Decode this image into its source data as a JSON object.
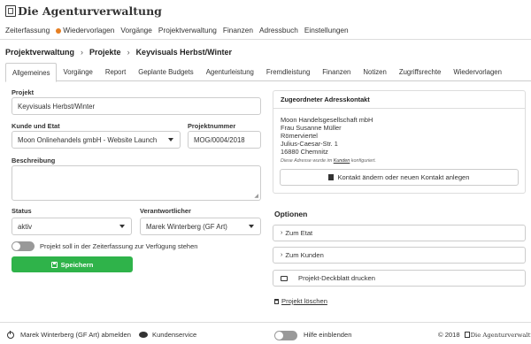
{
  "app": {
    "title": "Die Agenturverwaltung"
  },
  "topnav": [
    "Zeiterfassung",
    "Wiedervorlagen",
    "Vorgänge",
    "Projektverwaltung",
    "Finanzen",
    "Adressbuch",
    "Einstellungen"
  ],
  "breadcrumb": [
    "Projektverwaltung",
    "Projekte",
    "Keyvisuals Herbst/Winter"
  ],
  "tabs": [
    "Allgemeines",
    "Vorgänge",
    "Report",
    "Geplante Budgets",
    "Agenturleistung",
    "Fremdleistung",
    "Finanzen",
    "Notizen",
    "Zugriffsrechte",
    "Wiedervorlagen"
  ],
  "form": {
    "projekt_label": "Projekt",
    "projekt_value": "Keyvisuals Herbst/Winter",
    "kunde_label": "Kunde und Etat",
    "kunde_value": "Moon Onlinehandels gmbH - Website Launch",
    "projektnummer_label": "Projektnummer",
    "projektnummer_value": "MOG/0004/2018",
    "beschreibung_label": "Beschreibung",
    "beschreibung_value": "",
    "status_label": "Status",
    "status_value": "aktiv",
    "verantwortlich_label": "Verantwortlicher",
    "verantwortlich_value": "Marek Winterberg (GF Art)",
    "zeiterfassung_toggle_label": "Projekt soll in der Zeiterfassung zur Verfügung stehen",
    "save_label": "Speichern"
  },
  "contact": {
    "title": "Zugeordneter Adresskontakt",
    "lines": [
      "Moon Handelsgesellschaft mbH",
      "Frau Susanne Müller",
      "Römerviertel",
      "Julius-Caesar-Str. 1",
      "16880 Chemnitz"
    ],
    "note_prefix": "Diese Adresse wurde im ",
    "note_link": "Kunden",
    "note_suffix": " konfiguriert.",
    "change_button": "Kontakt ändern oder neuen Kontakt anlegen"
  },
  "options": {
    "title": "Optionen",
    "etat": "Zum Etat",
    "kunde": "Zum Kunden",
    "deckblatt": "Projekt-Deckblatt drucken",
    "delete": "Projekt löschen"
  },
  "footer": {
    "logout": "Marek Winterberg (GF Art) abmelden",
    "service": "Kundenservice",
    "help": "Hilfe einblenden",
    "copyright": "© 2018",
    "brand": "Die Agenturverwaltung"
  }
}
